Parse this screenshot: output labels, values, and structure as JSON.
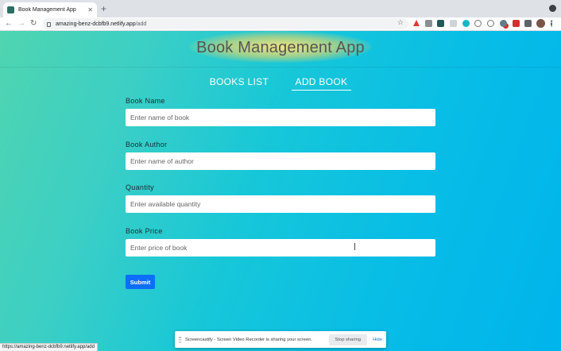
{
  "browser": {
    "tab_title": "Book Management App",
    "tab_close": "✕",
    "new_tab": "+",
    "url_host": "amazing-benz-dcbfb9.netlify.app",
    "url_path": "/add",
    "back": "←",
    "forward": "→",
    "reload": "↻",
    "star": "☆"
  },
  "app": {
    "title": "Book Management App",
    "nav": {
      "books_list": "BOOKS LIST",
      "add_book": "ADD BOOK"
    }
  },
  "form": {
    "book_name": {
      "label": "Book Name",
      "placeholder": "Enter name of book",
      "value": ""
    },
    "book_author": {
      "label": "Book Author",
      "placeholder": "Enter name of author",
      "value": ""
    },
    "quantity": {
      "label": "Quantity",
      "placeholder": "Enter available quantity",
      "value": ""
    },
    "book_price": {
      "label": "Book Price",
      "placeholder": "Enter price of book",
      "value": ""
    },
    "submit_label": "Submit"
  },
  "status_url": "https://amazing-benz-dcbfb9.netlify.app/add",
  "screencastify": {
    "message": "Screencastify - Screen Video Recorder is sharing your screen.",
    "stop": "Stop sharing",
    "hide": "Hide"
  },
  "colors": {
    "accent": "#0d6efd",
    "gradient_start": "#4fd5b0",
    "gradient_end": "#00b4ec"
  }
}
